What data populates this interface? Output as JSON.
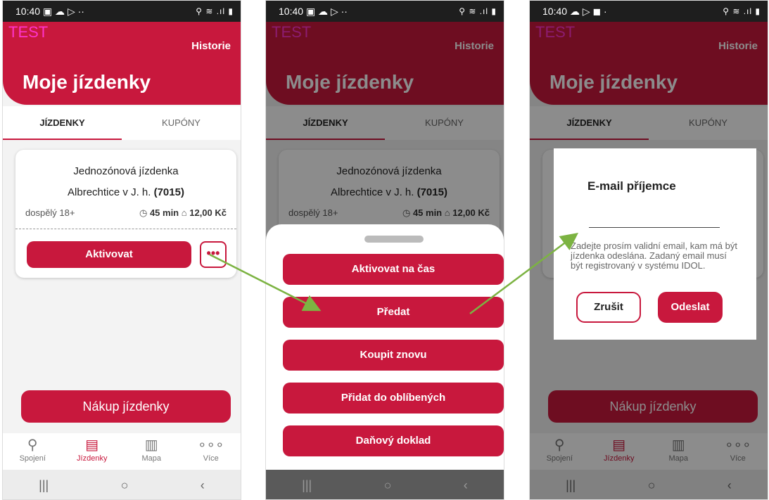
{
  "status": {
    "time": "10:40",
    "icons_s1": "▣ ☁ ▷ ··",
    "icons_s2": "▣ ☁ ▷ ··",
    "icons_s3": "☁ ▷ ◼ ·",
    "right": "⚲ ≋ .ıl ▮"
  },
  "header": {
    "test_label": "TEST",
    "history": "Historie",
    "title": "Moje jízdenky"
  },
  "tabs": {
    "tickets": "JÍZDENKY",
    "coupons": "KUPÓNY"
  },
  "ticket": {
    "name": "Jednozónová jízdenka",
    "route": "Albrechtice v J. h.",
    "code": "(7015)",
    "passenger": "dospělý 18+",
    "duration": "45 min",
    "price": "12,00 Kč",
    "activate": "Aktivovat",
    "more": "•••"
  },
  "buy_button": "Nákup jízdenky",
  "nav": {
    "connections": "Spojení",
    "tickets": "Jízdenky",
    "map": "Mapa",
    "more": "Více"
  },
  "sheet": {
    "options": [
      "Aktivovat na čas",
      "Předat",
      "Koupit znovu",
      "Přidat do oblíbených",
      "Daňový doklad"
    ]
  },
  "dialog": {
    "title": "E-mail příjemce",
    "hint": "Zadejte prosím validní email, kam má být jízdenka odeslána. Zadaný email musí být registrovaný v systému IDOL.",
    "cancel": "Zrušit",
    "send": "Odeslat"
  },
  "colors": {
    "brand": "#c8183d",
    "arrow": "#7cb342"
  }
}
